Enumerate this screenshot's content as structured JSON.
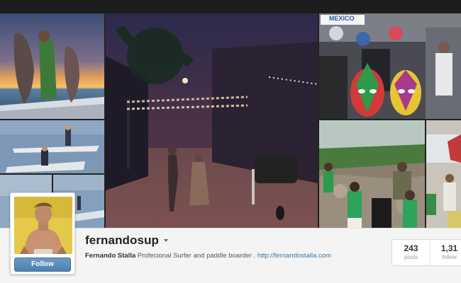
{
  "profile": {
    "username": "fernandosup",
    "full_name": "Fernando Stalla",
    "bio": "Profecional Surfer and paddle boarder .",
    "website": "http://fernandostalla.com",
    "follow_label": "Follow"
  },
  "stats": [
    {
      "value": "243",
      "label": "posts"
    },
    {
      "value": "1,31",
      "label": "follow"
    }
  ],
  "mosaic": {
    "tiles": [
      "fishing-sunset-photo",
      "paddleboard-photo-1",
      "paddleboard-photo-2",
      "paddleboard-photo-3",
      "night-street-photo",
      "lucha-masks-photo",
      "kids-beach-cleanup-photo",
      "beach-photo-partial"
    ],
    "banner_text": "MEXICO"
  }
}
